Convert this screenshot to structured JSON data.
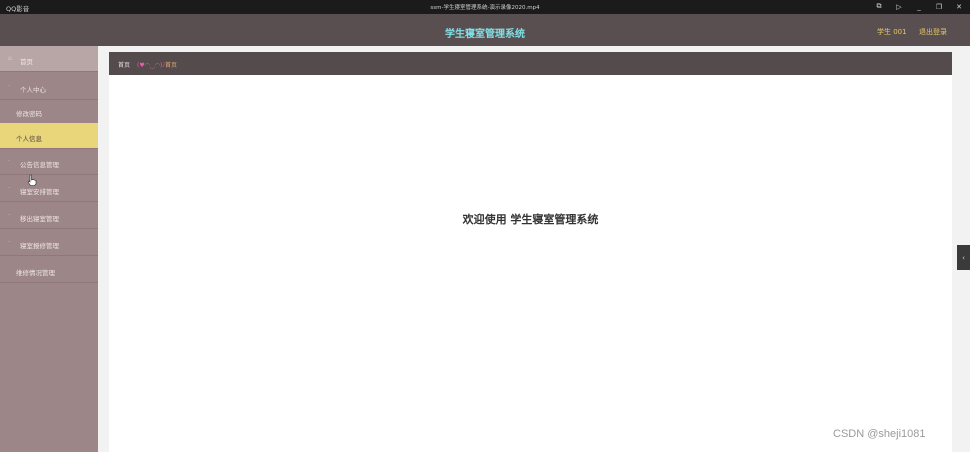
{
  "player": {
    "app_name": "QQ影音",
    "file_title": "ssm-学生寝室管理系统-演示录像2020.mp4",
    "controls": {
      "screenshot_icon": "⧉",
      "play_icon": "▷",
      "minimize_icon": "_",
      "restore_icon": "❐",
      "close_icon": "✕"
    }
  },
  "header": {
    "title": "学生寝室管理系统",
    "user_label": "学生 001",
    "logout_label": "退出登录"
  },
  "sidebar": {
    "items": [
      {
        "label": "首页",
        "icon": "home-icon",
        "glyph": "⌂"
      },
      {
        "label": "个人中心",
        "icon": "user-icon",
        "glyph": "·"
      },
      {
        "label": "修改密码",
        "icon": "",
        "glyph": ""
      },
      {
        "label": "个人信息",
        "icon": "",
        "glyph": ""
      },
      {
        "label": "公告信息管理",
        "icon": "notice-icon",
        "glyph": "·"
      },
      {
        "label": "寝室安排管理",
        "icon": "room-icon",
        "glyph": "·"
      },
      {
        "label": "移出寝室管理",
        "icon": "move-icon",
        "glyph": "·"
      },
      {
        "label": "寝室报修管理",
        "icon": "repair-icon",
        "glyph": "·"
      },
      {
        "label": "维修情况管理",
        "icon": "",
        "glyph": ""
      }
    ]
  },
  "breadcrumb": {
    "home": "首页",
    "separator": "(♥◠‿◠)ﾉ",
    "current": "首页"
  },
  "main": {
    "welcome_text": "欢迎使用 学生寝室管理系统"
  },
  "edge_tab": {
    "glyph": "‹"
  },
  "watermark": "CSDN @sheji1081",
  "colors": {
    "header_bg": "#5a4f50",
    "title_color": "#80e0e6",
    "accent_yellow": "#e2c86a",
    "sidebar_bg": "#9c8687",
    "active_item_bg": "#e9d57a"
  }
}
